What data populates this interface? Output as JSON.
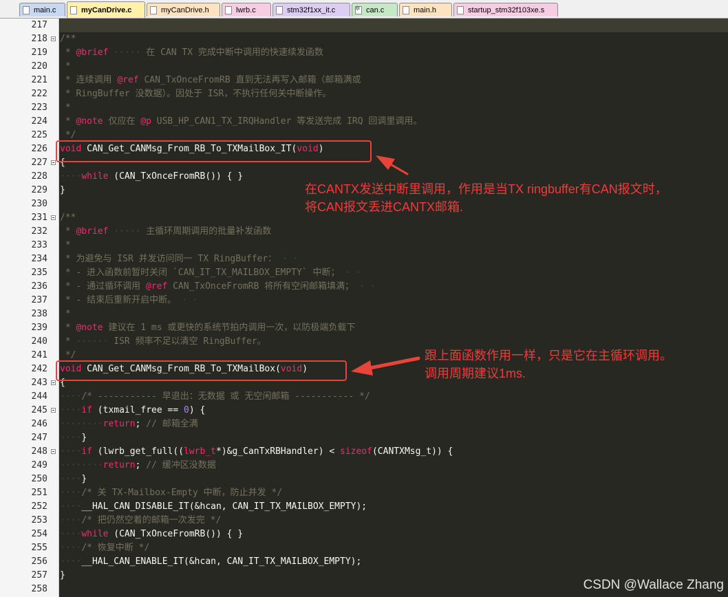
{
  "tabs": [
    {
      "label": "main.c",
      "color": "#c8d8f0",
      "icon": "c-file-icon"
    },
    {
      "label": "myCanDrive.c",
      "color": "#fff2a8",
      "icon": "c-file-icon",
      "active": true
    },
    {
      "label": "myCanDrive.h",
      "color": "#fde3c0",
      "icon": "h-file-icon"
    },
    {
      "label": "lwrb.c",
      "color": "#f7cde3",
      "icon": "c-file-icon"
    },
    {
      "label": "stm32f1xx_it.c",
      "color": "#dccdf2",
      "icon": "c-file-icon"
    },
    {
      "label": "can.c",
      "color": "#c6e8c6",
      "icon": "gear-file-icon"
    },
    {
      "label": "main.h",
      "color": "#fde3c0",
      "icon": "h-file-icon"
    },
    {
      "label": "startup_stm32f103xe.s",
      "color": "#f7cde3",
      "icon": "s-file-icon"
    }
  ],
  "lines": [
    {
      "n": "217",
      "fold": false,
      "code": []
    },
    {
      "n": "218",
      "fold": true,
      "code": [
        [
          "c",
          "/**"
        ]
      ]
    },
    {
      "n": "219",
      "fold": false,
      "code": [
        [
          "c",
          " * "
        ],
        [
          "k",
          "@brief"
        ],
        [
          "d",
          " ····· "
        ],
        [
          "c",
          "在 CAN TX 完成中断中调用的快速续发函数"
        ]
      ]
    },
    {
      "n": "220",
      "fold": false,
      "code": [
        [
          "c",
          " *"
        ]
      ]
    },
    {
      "n": "221",
      "fold": false,
      "code": [
        [
          "c",
          " * 连续调用 "
        ],
        [
          "k",
          "@ref"
        ],
        [
          "c",
          " CAN_TxOnceFromRB 直到无法再写入邮箱（邮箱满或"
        ]
      ]
    },
    {
      "n": "222",
      "fold": false,
      "code": [
        [
          "c",
          " * RingBuffer 没数据）。因处于 ISR，不执行任何关中断操作。"
        ]
      ]
    },
    {
      "n": "223",
      "fold": false,
      "code": [
        [
          "c",
          " *"
        ]
      ]
    },
    {
      "n": "224",
      "fold": false,
      "code": [
        [
          "c",
          " * "
        ],
        [
          "k",
          "@note"
        ],
        [
          "c",
          " 仅应在 "
        ],
        [
          "k",
          "@p"
        ],
        [
          "c",
          " USB_HP_CAN1_TX_IRQHandler 等发送完成 IRQ 回调里调用。"
        ]
      ]
    },
    {
      "n": "225",
      "fold": false,
      "code": [
        [
          "c",
          " */"
        ]
      ]
    },
    {
      "n": "226",
      "fold": false,
      "code": [
        [
          "t",
          "void"
        ],
        [
          "p",
          " CAN_Get_CANMsg_From_RB_To_TXMailBox_IT("
        ],
        [
          "t",
          "void"
        ],
        [
          "p",
          ")"
        ]
      ]
    },
    {
      "n": "227",
      "fold": true,
      "code": [
        [
          "p",
          "{"
        ]
      ]
    },
    {
      "n": "228",
      "fold": false,
      "code": [
        [
          "d",
          "····"
        ],
        [
          "k",
          "while"
        ],
        [
          "p",
          " (CAN_TxOnceFromRB()) { }"
        ]
      ]
    },
    {
      "n": "229",
      "fold": false,
      "code": [
        [
          "p",
          "}"
        ]
      ]
    },
    {
      "n": "230",
      "fold": false,
      "code": []
    },
    {
      "n": "231",
      "fold": true,
      "code": [
        [
          "c",
          "/**"
        ]
      ]
    },
    {
      "n": "232",
      "fold": false,
      "code": [
        [
          "c",
          " * "
        ],
        [
          "k",
          "@brief"
        ],
        [
          "d",
          " ····· "
        ],
        [
          "c",
          "主循环周期调用的批量补发函数"
        ]
      ]
    },
    {
      "n": "233",
      "fold": false,
      "code": [
        [
          "c",
          " *"
        ]
      ]
    },
    {
      "n": "234",
      "fold": false,
      "code": [
        [
          "c",
          " * 为避免与 ISR 并发访问同一 TX RingBuffer："
        ],
        [
          "d",
          " · ·"
        ]
      ]
    },
    {
      "n": "235",
      "fold": false,
      "code": [
        [
          "c",
          " * - 进入函数前暂时关闭 `CAN_IT_TX_MAILBOX_EMPTY` 中断；"
        ],
        [
          "d",
          " · ·"
        ]
      ]
    },
    {
      "n": "236",
      "fold": false,
      "code": [
        [
          "c",
          " * - 通过循环调用 "
        ],
        [
          "k",
          "@ref"
        ],
        [
          "c",
          " CAN_TxOnceFromRB 将所有空闲邮箱填满；"
        ],
        [
          "d",
          " · ·"
        ]
      ]
    },
    {
      "n": "237",
      "fold": false,
      "code": [
        [
          "c",
          " * - 结束后重新开启中断。"
        ],
        [
          "d",
          " · ·"
        ]
      ]
    },
    {
      "n": "238",
      "fold": false,
      "code": [
        [
          "c",
          " *"
        ]
      ]
    },
    {
      "n": "239",
      "fold": false,
      "code": [
        [
          "c",
          " * "
        ],
        [
          "k",
          "@note"
        ],
        [
          "c",
          " 建议在 1 ms 或更快的系统节拍内调用一次，以防极端负载下"
        ]
      ]
    },
    {
      "n": "240",
      "fold": false,
      "code": [
        [
          "c",
          " * "
        ],
        [
          "d",
          "······ "
        ],
        [
          "c",
          "ISR 频率不足以清空 RingBuffer。"
        ]
      ]
    },
    {
      "n": "241",
      "fold": false,
      "code": [
        [
          "c",
          " */"
        ]
      ]
    },
    {
      "n": "242",
      "fold": false,
      "code": [
        [
          "t",
          "void"
        ],
        [
          "p",
          " CAN_Get_CANMsg_From_RB_To_TXMailBox("
        ],
        [
          "t",
          "void"
        ],
        [
          "p",
          ")"
        ]
      ]
    },
    {
      "n": "243",
      "fold": true,
      "code": [
        [
          "p",
          "{"
        ]
      ]
    },
    {
      "n": "244",
      "fold": false,
      "code": [
        [
          "d",
          "····"
        ],
        [
          "c",
          "/* ----------- 早退出：无数据 或 无空闲邮箱 ----------- */"
        ]
      ]
    },
    {
      "n": "245",
      "fold": true,
      "code": [
        [
          "d",
          "····"
        ],
        [
          "k",
          "if"
        ],
        [
          "p",
          " (txmail_free == "
        ],
        [
          "n",
          "0"
        ],
        [
          "p",
          ") {"
        ]
      ]
    },
    {
      "n": "246",
      "fold": false,
      "code": [
        [
          "d",
          "········"
        ],
        [
          "k",
          "return"
        ],
        [
          "p",
          ";"
        ],
        [
          "c",
          " // 邮箱全满"
        ]
      ]
    },
    {
      "n": "247",
      "fold": false,
      "code": [
        [
          "d",
          "····"
        ],
        [
          "p",
          "}"
        ]
      ]
    },
    {
      "n": "248",
      "fold": true,
      "code": [
        [
          "d",
          "····"
        ],
        [
          "k",
          "if"
        ],
        [
          "p",
          " (lwrb_get_full(("
        ],
        [
          "k",
          "lwrb_t"
        ],
        [
          "p",
          "*)&g_CanTxRBHandler) < "
        ],
        [
          "k",
          "sizeof"
        ],
        [
          "p",
          "(CANTXMsg_t)) {"
        ]
      ]
    },
    {
      "n": "249",
      "fold": false,
      "code": [
        [
          "d",
          "········"
        ],
        [
          "k",
          "return"
        ],
        [
          "p",
          ";"
        ],
        [
          "c",
          " // 缓冲区没数据"
        ]
      ]
    },
    {
      "n": "250",
      "fold": false,
      "code": [
        [
          "d",
          "····"
        ],
        [
          "p",
          "}"
        ]
      ]
    },
    {
      "n": "251",
      "fold": false,
      "code": [
        [
          "d",
          "····"
        ],
        [
          "c",
          "/* 关 TX-Mailbox-Empty 中断，防止并发 */"
        ]
      ]
    },
    {
      "n": "252",
      "fold": false,
      "code": [
        [
          "d",
          "····"
        ],
        [
          "p",
          "__HAL_CAN_DISABLE_IT(&hcan, CAN_IT_TX_MAILBOX_EMPTY);"
        ]
      ]
    },
    {
      "n": "253",
      "fold": false,
      "code": [
        [
          "d",
          "····"
        ],
        [
          "c",
          "/* 把仍然空着的邮箱一次发完 */"
        ]
      ]
    },
    {
      "n": "254",
      "fold": false,
      "code": [
        [
          "d",
          "····"
        ],
        [
          "k",
          "while"
        ],
        [
          "p",
          " (CAN_TxOnceFromRB()) { }"
        ]
      ]
    },
    {
      "n": "255",
      "fold": false,
      "code": [
        [
          "d",
          "····"
        ],
        [
          "c",
          "/* 恢复中断 */"
        ]
      ]
    },
    {
      "n": "256",
      "fold": false,
      "code": [
        [
          "d",
          "····"
        ],
        [
          "p",
          "__HAL_CAN_ENABLE_IT(&hcan, CAN_IT_TX_MAILBOX_EMPTY);"
        ]
      ]
    },
    {
      "n": "257",
      "fold": false,
      "code": [
        [
          "p",
          "}"
        ]
      ]
    },
    {
      "n": "258",
      "fold": false,
      "code": []
    }
  ],
  "annotations": {
    "note1_line1": "在CANTX发送中断里调用，作用是当TX ringbuffer有CAN报文时，",
    "note1_line2": "将CAN报文丢进CANTX邮箱.",
    "note2_line1": "跟上面函数作用一样，只是它在主循环调用。",
    "note2_line2": "调用周期建议1ms."
  },
  "watermark": "CSDN @Wallace Zhang",
  "colors": {
    "editor_bg": "#272822",
    "keyword": "#f92672",
    "comment": "#75715e",
    "number": "#ae81ff",
    "annotation": "#e8443a"
  }
}
